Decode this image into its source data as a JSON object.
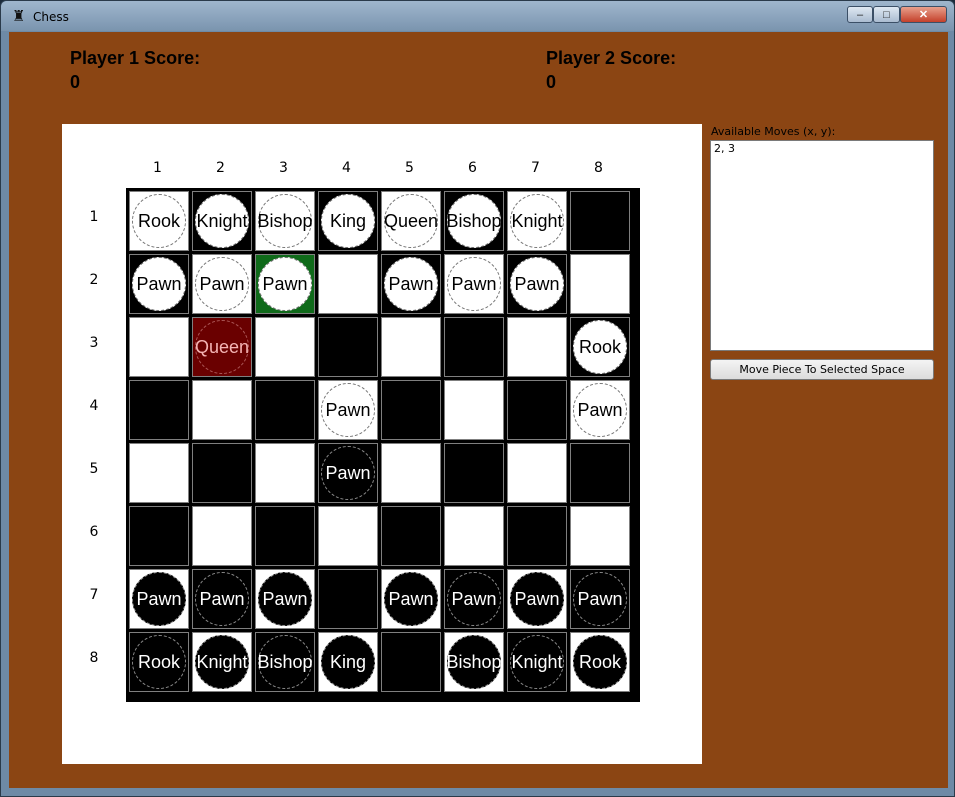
{
  "window": {
    "title": "Chess",
    "icon": "chess-rook-icon",
    "minimize_glyph": "–",
    "maximize_glyph": "□",
    "close_glyph": "✕"
  },
  "scores": {
    "player1": {
      "label": "Player 1 Score:",
      "value": "0"
    },
    "player2": {
      "label": "Player 2 Score:",
      "value": "0"
    }
  },
  "board": {
    "col_labels": [
      "1",
      "2",
      "3",
      "4",
      "5",
      "6",
      "7",
      "8"
    ],
    "row_labels": [
      "1",
      "2",
      "3",
      "4",
      "5",
      "6",
      "7",
      "8"
    ],
    "rows": [
      [
        {
          "color": "light",
          "piece": "Rook",
          "side": "white"
        },
        {
          "color": "dark",
          "piece": "Knight",
          "side": "white"
        },
        {
          "color": "light",
          "piece": "Bishop",
          "side": "white"
        },
        {
          "color": "dark",
          "piece": "King",
          "side": "white"
        },
        {
          "color": "light",
          "piece": "Queen",
          "side": "white"
        },
        {
          "color": "dark",
          "piece": "Bishop",
          "side": "white"
        },
        {
          "color": "light",
          "piece": "Knight",
          "side": "white"
        },
        {
          "color": "dark",
          "piece": "",
          "side": ""
        }
      ],
      [
        {
          "color": "dark",
          "piece": "Pawn",
          "side": "white"
        },
        {
          "color": "light",
          "piece": "Pawn",
          "side": "white"
        },
        {
          "color": "sel-green",
          "piece": "Pawn",
          "side": "white"
        },
        {
          "color": "light",
          "piece": "",
          "side": ""
        },
        {
          "color": "dark",
          "piece": "Pawn",
          "side": "white"
        },
        {
          "color": "light",
          "piece": "Pawn",
          "side": "white"
        },
        {
          "color": "dark",
          "piece": "Pawn",
          "side": "white"
        },
        {
          "color": "light",
          "piece": "",
          "side": ""
        }
      ],
      [
        {
          "color": "light",
          "piece": "",
          "side": ""
        },
        {
          "color": "sel-red",
          "piece": "Queen",
          "side": "sel-red"
        },
        {
          "color": "light",
          "piece": "",
          "side": ""
        },
        {
          "color": "dark",
          "piece": "",
          "side": ""
        },
        {
          "color": "light",
          "piece": "",
          "side": ""
        },
        {
          "color": "dark",
          "piece": "",
          "side": ""
        },
        {
          "color": "light",
          "piece": "",
          "side": ""
        },
        {
          "color": "dark",
          "piece": "Rook",
          "side": "white"
        }
      ],
      [
        {
          "color": "dark",
          "piece": "",
          "side": ""
        },
        {
          "color": "light",
          "piece": "",
          "side": ""
        },
        {
          "color": "dark",
          "piece": "",
          "side": ""
        },
        {
          "color": "light",
          "piece": "Pawn",
          "side": "white"
        },
        {
          "color": "dark",
          "piece": "",
          "side": ""
        },
        {
          "color": "light",
          "piece": "",
          "side": ""
        },
        {
          "color": "dark",
          "piece": "",
          "side": ""
        },
        {
          "color": "light",
          "piece": "Pawn",
          "side": "white"
        }
      ],
      [
        {
          "color": "light",
          "piece": "",
          "side": ""
        },
        {
          "color": "dark",
          "piece": "",
          "side": ""
        },
        {
          "color": "light",
          "piece": "",
          "side": ""
        },
        {
          "color": "dark",
          "piece": "Pawn",
          "side": "black"
        },
        {
          "color": "light",
          "piece": "",
          "side": ""
        },
        {
          "color": "dark",
          "piece": "",
          "side": ""
        },
        {
          "color": "light",
          "piece": "",
          "side": ""
        },
        {
          "color": "dark",
          "piece": "",
          "side": ""
        }
      ],
      [
        {
          "color": "dark",
          "piece": "",
          "side": ""
        },
        {
          "color": "light",
          "piece": "",
          "side": ""
        },
        {
          "color": "dark",
          "piece": "",
          "side": ""
        },
        {
          "color": "light",
          "piece": "",
          "side": ""
        },
        {
          "color": "dark",
          "piece": "",
          "side": ""
        },
        {
          "color": "light",
          "piece": "",
          "side": ""
        },
        {
          "color": "dark",
          "piece": "",
          "side": ""
        },
        {
          "color": "light",
          "piece": "",
          "side": ""
        }
      ],
      [
        {
          "color": "light",
          "piece": "Pawn",
          "side": "black"
        },
        {
          "color": "dark",
          "piece": "Pawn",
          "side": "black"
        },
        {
          "color": "light",
          "piece": "Pawn",
          "side": "black"
        },
        {
          "color": "dark",
          "piece": "",
          "side": ""
        },
        {
          "color": "light",
          "piece": "Pawn",
          "side": "black"
        },
        {
          "color": "dark",
          "piece": "Pawn",
          "side": "black"
        },
        {
          "color": "light",
          "piece": "Pawn",
          "side": "black"
        },
        {
          "color": "dark",
          "piece": "Pawn",
          "side": "black"
        }
      ],
      [
        {
          "color": "dark",
          "piece": "Rook",
          "side": "black"
        },
        {
          "color": "light",
          "piece": "Knight",
          "side": "black"
        },
        {
          "color": "dark",
          "piece": "Bishop",
          "side": "black"
        },
        {
          "color": "light",
          "piece": "King",
          "side": "black"
        },
        {
          "color": "dark",
          "piece": "",
          "side": ""
        },
        {
          "color": "light",
          "piece": "Bishop",
          "side": "black"
        },
        {
          "color": "dark",
          "piece": "Knight",
          "side": "black"
        },
        {
          "color": "light",
          "piece": "Rook",
          "side": "black"
        }
      ]
    ]
  },
  "sidebar": {
    "moves_label": "Available Moves (x, y):",
    "moves": [
      "2, 3"
    ],
    "move_button_label": "Move Piece To Selected Space"
  },
  "colors": {
    "background": "#8b4513",
    "selected_piece": "#0f6a1a",
    "target_square": "#6a0000"
  }
}
